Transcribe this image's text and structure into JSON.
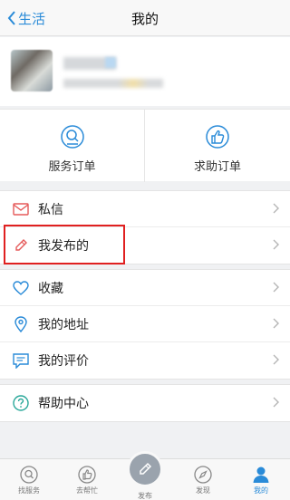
{
  "nav": {
    "back_label": "生活",
    "title": "我的"
  },
  "orders": [
    {
      "label": "服务订单",
      "icon": "search-order-icon"
    },
    {
      "label": "求助订单",
      "icon": "thumbs-up-icon"
    }
  ],
  "menu": {
    "group1": [
      {
        "label": "私信",
        "icon": "envelope-icon",
        "color": "#e55a5a"
      },
      {
        "label": "我发布的",
        "icon": "pencil-icon",
        "color": "#e55a5a"
      }
    ],
    "group2": [
      {
        "label": "收藏",
        "icon": "heart-icon",
        "color": "#2a8bd8"
      },
      {
        "label": "我的地址",
        "icon": "location-pin-icon",
        "color": "#2a8bd8"
      },
      {
        "label": "我的评价",
        "icon": "comment-icon",
        "color": "#2a8bd8"
      }
    ],
    "group3": [
      {
        "label": "帮助中心",
        "icon": "question-icon",
        "color": "#2aa89a"
      }
    ]
  },
  "tabbar": [
    {
      "label": "找服务",
      "icon": "find-service-icon"
    },
    {
      "label": "去帮忙",
      "icon": "help-hand-icon"
    },
    {
      "label": "发布",
      "icon": "publish-pencil-icon"
    },
    {
      "label": "发现",
      "icon": "compass-icon"
    },
    {
      "label": "我的",
      "icon": "user-icon",
      "active": true
    }
  ],
  "colors": {
    "accent": "#2a8bd8",
    "highlight_border": "#e02020"
  }
}
